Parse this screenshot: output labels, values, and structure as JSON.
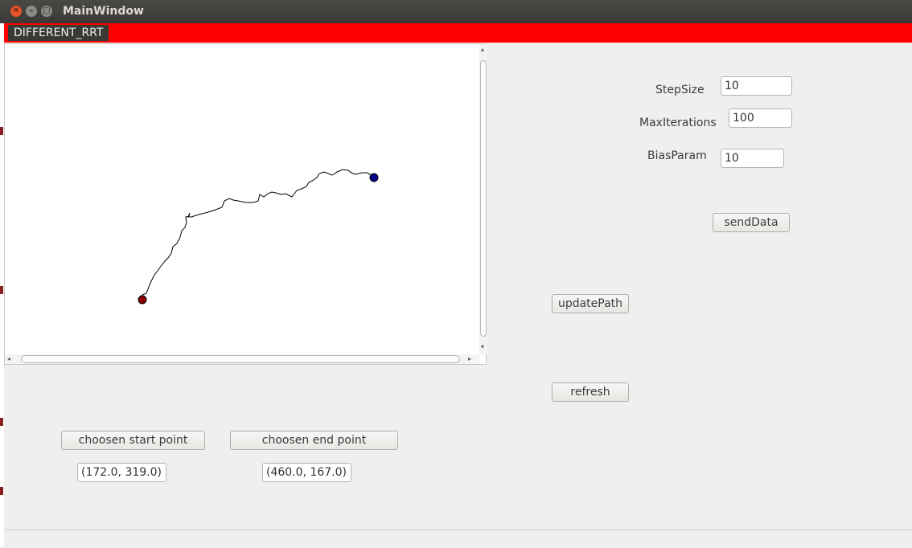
{
  "window": {
    "title": "MainWindow"
  },
  "menu": {
    "items": [
      "DIFFERENT_RRT"
    ]
  },
  "params": {
    "step_size_label": "StepSize",
    "step_size_value": "10",
    "max_iter_label": "MaxIterations",
    "max_iter_value": "100",
    "bias_label": "BiasParam",
    "bias_value": "10"
  },
  "buttons": {
    "send_data": "sendData",
    "update_path": "updatePath",
    "refresh": "refresh",
    "start_point": "choosen start point",
    "end_point": "choosen end point"
  },
  "points": {
    "start_value": "(172.0, 319.0)",
    "end_value": "(460.0, 167.0)"
  },
  "colors": {
    "menubar": "#ff0000",
    "start_marker": "#8b0000",
    "end_marker": "#00008b",
    "path": "#000000"
  }
}
